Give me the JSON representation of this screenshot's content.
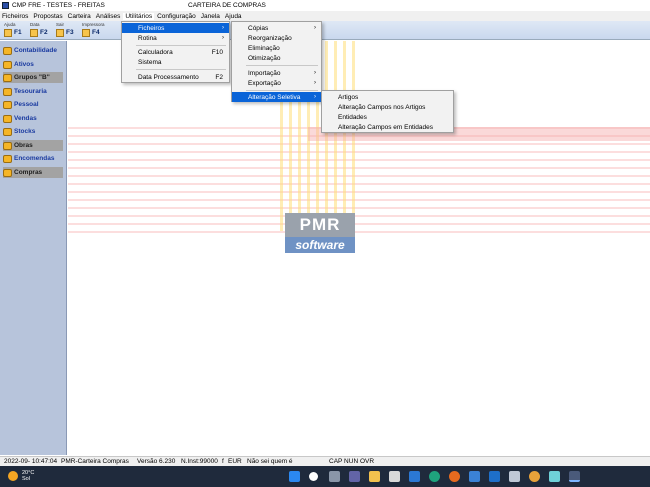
{
  "window": {
    "app_title": "CMP FRE - TESTES - FREITAS",
    "title": "CARTEIRA DE COMPRAS"
  },
  "menubar": [
    "Ficheiros",
    "Propostas",
    "Carteira",
    "Análises",
    "Utilitários",
    "Configuração",
    "Janela",
    "Ajuda"
  ],
  "toolbar": [
    {
      "caption": "Ajuda",
      "key": "F1"
    },
    {
      "caption": "Data",
      "key": "F2"
    },
    {
      "caption": "Sair",
      "key": "F3"
    },
    {
      "caption": "Impressora",
      "key": "F4"
    }
  ],
  "sidebar": [
    {
      "label": "Contabilidade",
      "gray": false
    },
    {
      "label": "Ativos",
      "gray": false
    },
    {
      "label": "Grupos \"B\"",
      "gray": true
    },
    {
      "label": "Tesouraria",
      "gray": false
    },
    {
      "label": "Pessoal",
      "gray": false
    },
    {
      "label": "Vendas",
      "gray": false
    },
    {
      "label": "Stocks",
      "gray": false
    },
    {
      "label": "Obras",
      "gray": true
    },
    {
      "label": "Encomendas",
      "gray": false
    },
    {
      "label": "Compras",
      "gray": true
    }
  ],
  "utilitarios_menu": {
    "items": [
      {
        "label": "Ficheiros",
        "shortcut": "",
        "submenu": true,
        "highlight": true
      },
      {
        "label": "Rotina",
        "shortcut": "",
        "submenu": true,
        "highlight": false
      },
      {
        "label": "Calculadora",
        "shortcut": "F10",
        "submenu": false,
        "highlight": false
      },
      {
        "label": "Sistema",
        "shortcut": "",
        "submenu": false,
        "highlight": false
      },
      {
        "label": "Data Processamento",
        "shortcut": "F2",
        "submenu": false,
        "highlight": false
      }
    ]
  },
  "ficheiros_menu": {
    "items": [
      {
        "label": "Cópias",
        "submenu": true,
        "highlight": false
      },
      {
        "label": "Reorganização",
        "submenu": false,
        "highlight": false
      },
      {
        "label": "Eliminação",
        "submenu": false,
        "highlight": false
      },
      {
        "label": "Otimização",
        "submenu": false,
        "highlight": false
      },
      {
        "label": "Importação",
        "submenu": true,
        "highlight": false
      },
      {
        "label": "Exportação",
        "submenu": true,
        "highlight": false
      },
      {
        "label": "Alteração Seletiva",
        "submenu": true,
        "highlight": true
      }
    ]
  },
  "alteracao_menu": {
    "items": [
      "Artigos",
      "Alteração Campos nos Artigos",
      "Entidades",
      "Alteração Campos em Entidades"
    ]
  },
  "logo": {
    "top": "PMR",
    "bottom": "software"
  },
  "statusbar": {
    "datetime": "2022-09-  10:47:04",
    "module": "PMR-Carteira Compras",
    "version": "Versão  6.230",
    "inst": "N.Inst:99000",
    "currency_flag": "f",
    "currency": "EUR",
    "user": "Não sei quem é",
    "keys": "CAP NUN OVR"
  },
  "taskbar": {
    "temp": "20°C",
    "weather": "Sol"
  },
  "colors": {
    "highlight": "#0a64d8",
    "sidebar_bg": "#b7c4db",
    "sidebar_text": "#1a3aa0",
    "taskbar": "#1f2a3c"
  }
}
